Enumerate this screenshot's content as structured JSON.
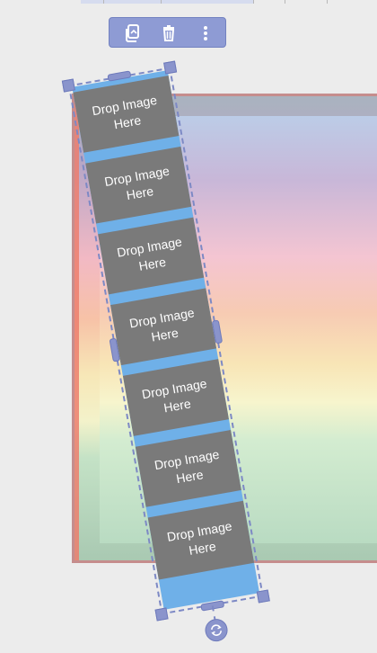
{
  "toolbar": {
    "buttons": [
      {
        "icon": "duplicate-icon"
      },
      {
        "icon": "delete-icon"
      },
      {
        "icon": "more-vertical-icon"
      }
    ]
  },
  "element": {
    "rotation_deg": -10,
    "placeholder_label": "Drop Image Here",
    "cells": [
      {
        "line1": "Drop Image",
        "line2": "Here"
      },
      {
        "line1": "Drop Image",
        "line2": "Here"
      },
      {
        "line1": "Drop Image",
        "line2": "Here"
      },
      {
        "line1": "Drop Image",
        "line2": "Here"
      },
      {
        "line1": "Drop Image",
        "line2": "Here"
      },
      {
        "line1": "Drop Image",
        "line2": "Here"
      },
      {
        "line1": "Drop Image",
        "line2": "Here"
      }
    ]
  },
  "colors": {
    "accent": "#8e9bd4",
    "cell_bg": "#7a7a7a",
    "strip_bg": "#6fb0e8",
    "canvas_border": "#c58d8d"
  },
  "rotate_handle": {
    "icon": "rotate-icon"
  }
}
